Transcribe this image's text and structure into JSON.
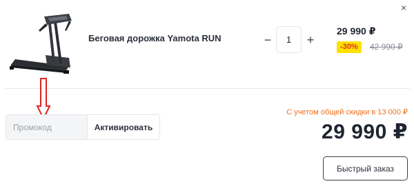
{
  "cart_item": {
    "name": "Беговая дорожка Yamota RUN",
    "image": "treadmill-image",
    "quantity": "1",
    "minus_label": "−",
    "plus_label": "+",
    "price": "29 990 ₽",
    "discount_badge": "-30%",
    "old_price": "42 990 ₽",
    "remove_label": "×"
  },
  "promo": {
    "placeholder": "Промокод",
    "value": "",
    "activate_label": "Активировать"
  },
  "summary": {
    "discount_note": "С учетом общей скидки в 13 000 ₽",
    "total": "29 990 ₽"
  },
  "actions": {
    "quick_order_label": "Быстрый заказ"
  },
  "colors": {
    "badge_bg": "#ffe100",
    "badge_text": "#e32b2b",
    "discount_note": "#f0701e",
    "annotation_arrow": "#e02020"
  }
}
